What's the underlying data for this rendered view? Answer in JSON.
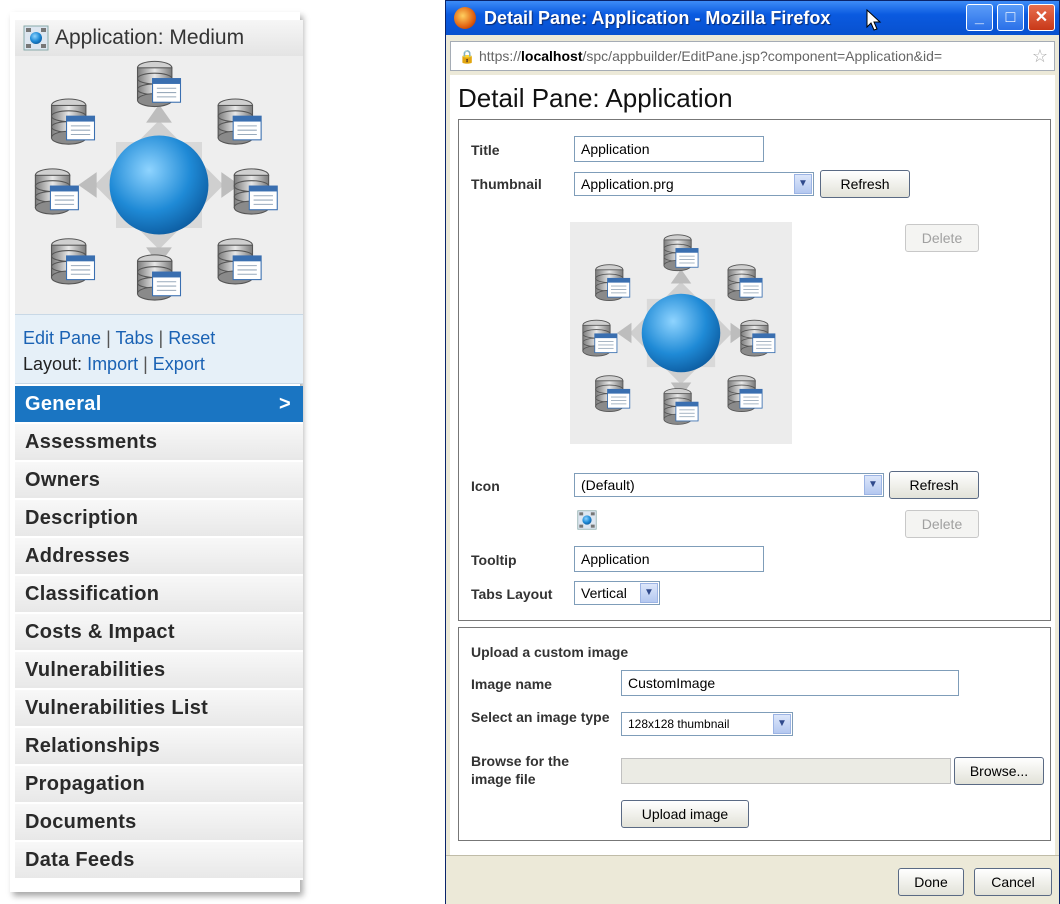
{
  "left_panel": {
    "title": "Application: Medium",
    "links": {
      "edit_pane": "Edit Pane",
      "tabs": "Tabs",
      "reset": "Reset",
      "layout_label": "Layout:",
      "import": "Import",
      "export": "Export",
      "separator": "|"
    },
    "nav_items": [
      "General",
      "Assessments",
      "Owners",
      "Description",
      "Addresses",
      "Classification",
      "Costs & Impact",
      "Vulnerabilities",
      "Vulnerabilities List",
      "Relationships",
      "Propagation",
      "Documents",
      "Data Feeds"
    ],
    "active_arrow": ">",
    "accent_color": "#1a75c2"
  },
  "browser": {
    "window_title": "Detail Pane: Application - Mozilla Firefox",
    "url_prefix": "https://",
    "url_host": "localhost",
    "url_rest": "/spc/appbuilder/EditPane.jsp?component=Application&id=",
    "heading": "Detail Pane: Application",
    "form": {
      "title_label": "Title",
      "title_value": "Application",
      "thumbnail_label": "Thumbnail",
      "thumbnail_value": "Application.prg",
      "refresh_label": "Refresh",
      "delete_label": "Delete",
      "icon_label": "Icon",
      "icon_value": "(Default)",
      "tooltip_label": "Tooltip",
      "tooltip_value": "Application",
      "tabs_layout_label": "Tabs Layout",
      "tabs_layout_value": "Vertical"
    },
    "upload": {
      "heading": "Upload a custom image",
      "image_name_label": "Image name",
      "image_name_value": "CustomImage",
      "image_type_label": "Select an image type",
      "image_type_value": "128x128 thumbnail",
      "browse_label": "Browse for the image file",
      "browse_button": "Browse...",
      "upload_button": "Upload image"
    },
    "done_button": "Done",
    "cancel_button": "Cancel"
  }
}
